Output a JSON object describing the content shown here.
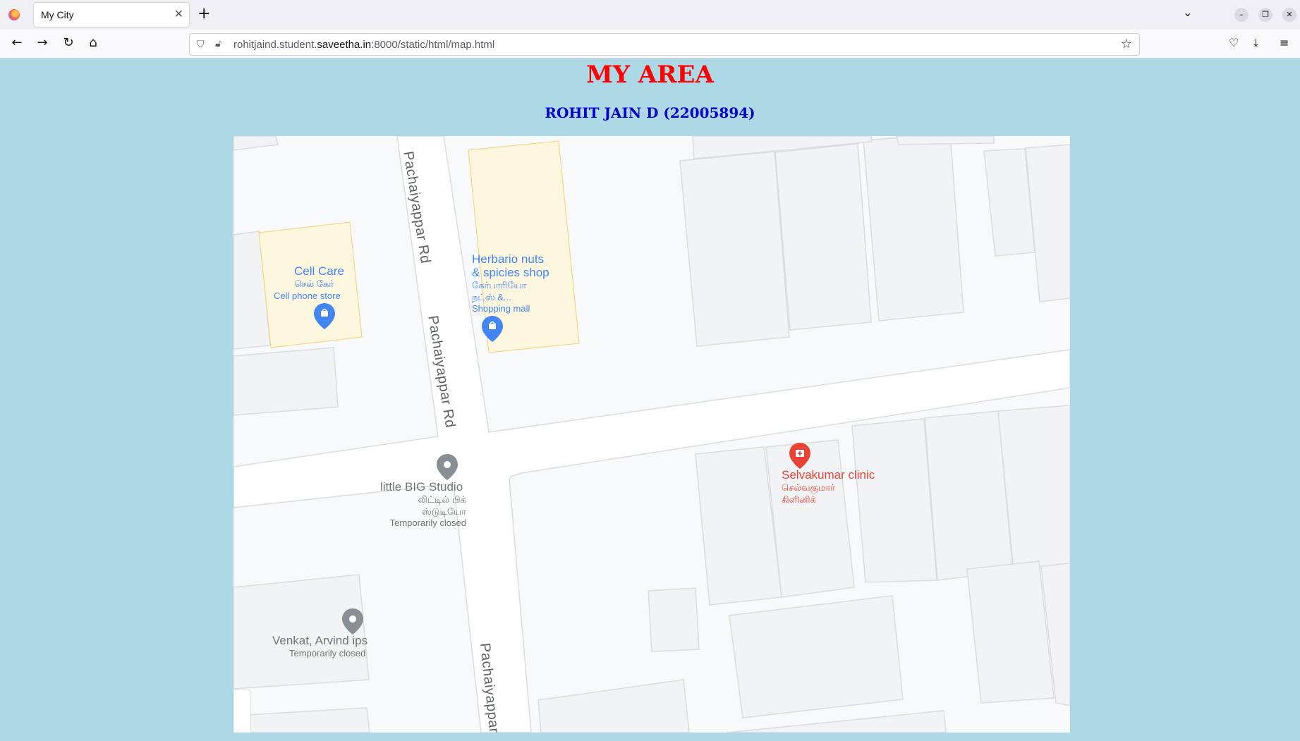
{
  "browser": {
    "tab_title": "My City",
    "url_host_prefix": "rohitjaind.student.",
    "url_host_domain": "saveetha.in",
    "url_path": ":8000/static/html/map.html"
  },
  "page": {
    "title": "MY AREA",
    "subtitle": "ROHIT JAIN D (22005894)"
  },
  "map": {
    "roads": [
      "Pachaiyappar Rd",
      "Pachaiyappar Rd",
      "Pachaiyappar"
    ],
    "places": [
      {
        "name": "Cell Care",
        "native": "செல் கேர்",
        "category": "Cell phone store",
        "color": "#4285f4"
      },
      {
        "name_line1": "Herbario nuts",
        "name_line2": "& spicies shop",
        "native_line1": "கேர்பாரியோ",
        "native_line2": "நட்ஸ் &...",
        "category": "Shopping mall",
        "color": "#4285f4"
      },
      {
        "name": "little BIG Studio",
        "native_line1": "லிட்டில் பிக்",
        "native_line2": "ஸ்டுடியோ",
        "status": "Temporarily closed",
        "color": "#70757a"
      },
      {
        "name": "Selvakumar clinic",
        "native_line1": "செல்வகுமார்",
        "native_line2": "கிளினிக்",
        "color": "#ea4335"
      },
      {
        "name": "Venkat, Arvind ips",
        "status": "Temporarily closed",
        "color": "#70757a"
      }
    ]
  },
  "colors": {
    "page_bg": "#add8e6",
    "title": "#ff0000",
    "subtitle": "#0000cd"
  }
}
